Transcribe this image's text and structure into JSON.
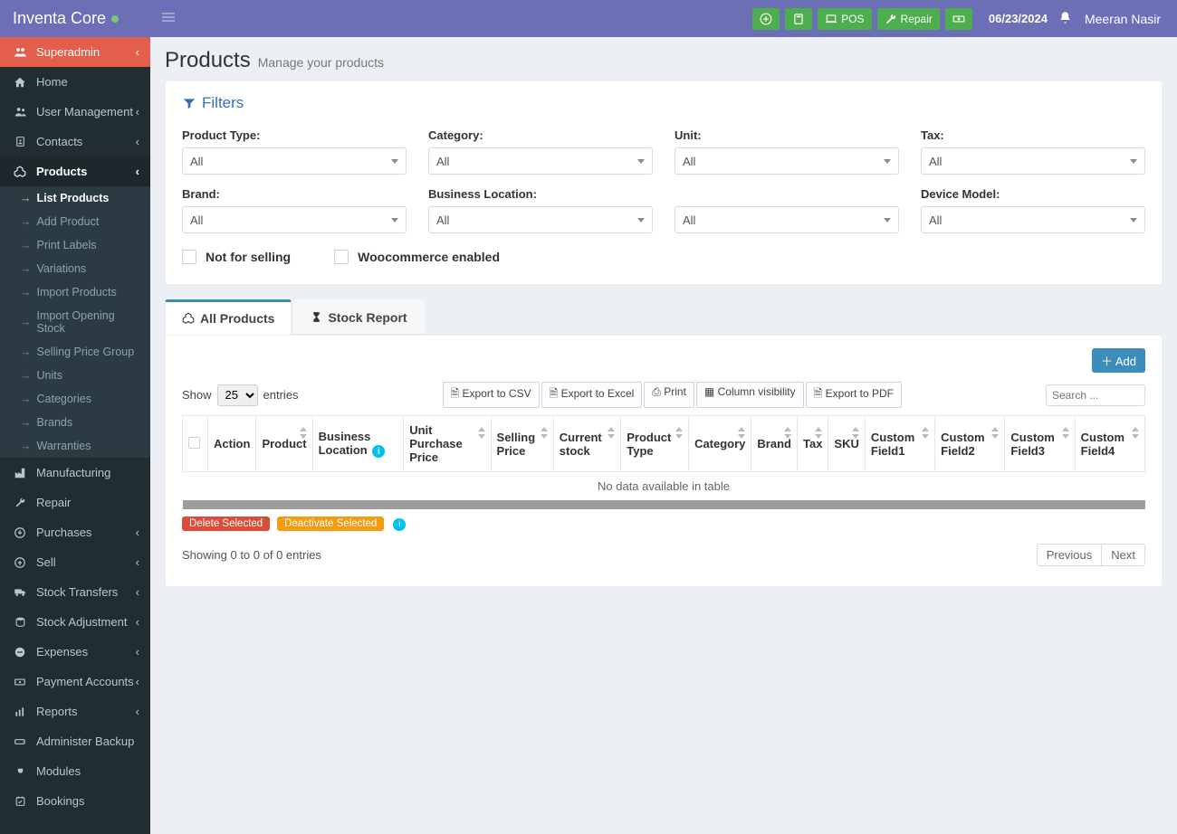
{
  "app": {
    "name": "Inventa Core"
  },
  "header": {
    "pos_label": "POS",
    "repair_label": "Repair",
    "date": "06/23/2024",
    "user": "Meeran Nasir"
  },
  "sidebar": {
    "items": [
      {
        "label": "Superadmin"
      },
      {
        "label": "Home"
      },
      {
        "label": "User Management"
      },
      {
        "label": "Contacts"
      },
      {
        "label": "Products"
      },
      {
        "label": "Manufacturing"
      },
      {
        "label": "Repair"
      },
      {
        "label": "Purchases"
      },
      {
        "label": "Sell"
      },
      {
        "label": "Stock Transfers"
      },
      {
        "label": "Stock Adjustment"
      },
      {
        "label": "Expenses"
      },
      {
        "label": "Payment Accounts"
      },
      {
        "label": "Reports"
      },
      {
        "label": "Administer Backup"
      },
      {
        "label": "Modules"
      },
      {
        "label": "Bookings"
      }
    ],
    "products_sub": [
      "List Products",
      "Add Product",
      "Print Labels",
      "Variations",
      "Import Products",
      "Import Opening Stock",
      "Selling Price Group",
      "Units",
      "Categories",
      "Brands",
      "Warranties"
    ]
  },
  "page": {
    "title": "Products",
    "subtitle": "Manage your products"
  },
  "filters": {
    "head": "Filters",
    "labels": {
      "product_type": "Product Type:",
      "category": "Category:",
      "unit": "Unit:",
      "tax": "Tax:",
      "brand": "Brand:",
      "business_location": "Business Location:",
      "empty": "",
      "device_model": "Device Model:"
    },
    "values": {
      "product_type": "All",
      "category": "All",
      "unit": "All",
      "tax": "All",
      "brand": "All",
      "business_location": "All",
      "unnamed": "All",
      "device_model": "All"
    },
    "checks": {
      "not_for_selling": "Not for selling",
      "woo": "Woocommerce enabled"
    }
  },
  "tabs": {
    "all": "All Products",
    "stock": "Stock Report"
  },
  "table": {
    "add": "Add",
    "show_prefix": "Show",
    "show_suffix": "entries",
    "page_length": "25",
    "export_csv": "Export to CSV",
    "export_excel": "Export to Excel",
    "print": "Print",
    "col_vis": "Column visibility",
    "export_pdf": "Export to PDF",
    "search_placeholder": "Search ...",
    "columns": [
      "Action",
      "Product",
      "Business Location",
      "Unit Purchase Price",
      "Selling Price",
      "Current stock",
      "Product Type",
      "Category",
      "Brand",
      "Tax",
      "SKU",
      "Custom Field1",
      "Custom Field2",
      "Custom Field3",
      "Custom Field4"
    ],
    "empty": "No data available in table",
    "delete_sel": "Delete Selected",
    "deactivate_sel": "Deactivate Selected",
    "summary": "Showing 0 to 0 of 0 entries",
    "prev": "Previous",
    "next": "Next"
  }
}
